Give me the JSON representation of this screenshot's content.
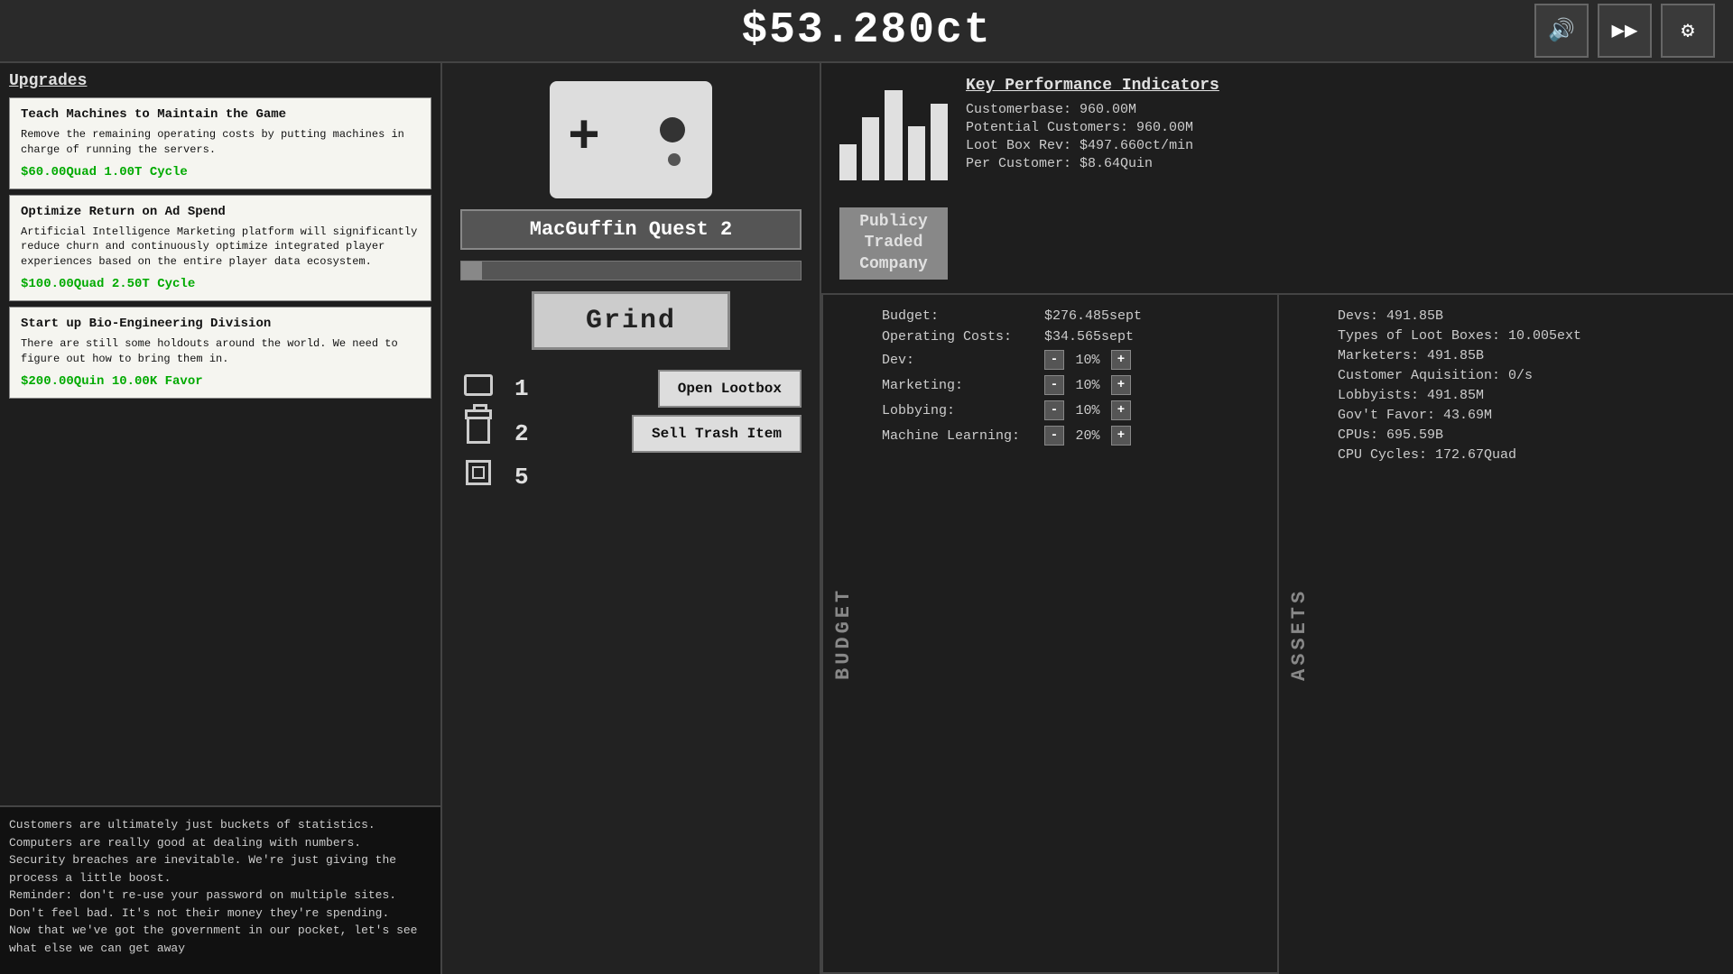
{
  "topbar": {
    "money": "$53.280ct"
  },
  "icons": {
    "sound": "🔊",
    "play": "▶",
    "settings": "⚙"
  },
  "upgrades": {
    "title": "Upgrades",
    "cards": [
      {
        "name": "Teach Machines to Maintain the Game",
        "desc": "Remove the remaining operating costs by putting machines in charge of running the servers.",
        "cost": "$60.00Quad  1.00T Cycle"
      },
      {
        "name": "Optimize Return on Ad Spend",
        "desc": "Artificial Intelligence Marketing platform will significantly reduce churn and continuously optimize integrated player experiences based on the entire player data ecosystem.",
        "cost": "$100.00Quad  2.50T Cycle"
      },
      {
        "name": "Start up Bio-Engineering Division",
        "desc": "There are still some holdouts around the world. We need to figure out how to bring them in.",
        "cost": "$200.00Quin  10.00K Favor"
      }
    ]
  },
  "log": {
    "lines": [
      "Customers are ultimately just buckets of statistics. Computers are really good at dealing with numbers.",
      "Security breaches are inevitable. We're just giving the process a little boost.",
      "Reminder: don't re-use your password on multiple sites.",
      "Don't feel bad. It's not their money they're spending.",
      "Now that we've got the government in our pocket, let's see what else we can get away"
    ]
  },
  "game": {
    "title": "MacGuffin Quest 2",
    "grind_label": "Grind",
    "progress": 6
  },
  "inventory": {
    "card_icon": "card",
    "card_count": "1",
    "trash_icon": "trash",
    "trash_count": "2",
    "cpu_icon": "cpu",
    "cpu_count": "5",
    "open_lootbox_label": "Open Lootbox",
    "sell_trash_label": "Sell Trash Item"
  },
  "kpi": {
    "title": "Key Performance Indicators",
    "company_label": "Publicy Traded\nCompany",
    "rows": [
      {
        "label": "Customerbase:",
        "value": "960.00M"
      },
      {
        "label": "Potential Customers:",
        "value": "960.00M"
      },
      {
        "label": "Loot Box Rev:",
        "value": "$497.660ct/min"
      },
      {
        "label": "Per Customer:",
        "value": "$8.64Quin"
      }
    ],
    "chart_bars": [
      40,
      70,
      100,
      60,
      85
    ]
  },
  "budget": {
    "section_label": "BUDGET",
    "rows": [
      {
        "label": "Budget:",
        "value": "$276.485sept",
        "has_controls": false
      },
      {
        "label": "Operating Costs:",
        "value": "$34.565sept",
        "has_controls": false
      },
      {
        "label": "Dev:",
        "value": "",
        "pct": "10%",
        "has_controls": true
      },
      {
        "label": "Marketing:",
        "value": "",
        "pct": "10%",
        "has_controls": true
      },
      {
        "label": "Lobbying:",
        "value": "",
        "pct": "10%",
        "has_controls": true
      },
      {
        "label": "Machine Learning:",
        "value": "",
        "pct": "20%",
        "has_controls": true
      }
    ]
  },
  "assets": {
    "section_label": "ASSETS",
    "rows": [
      {
        "label": "Devs:",
        "value": "491.85B"
      },
      {
        "label": "Types of Loot Boxes:",
        "value": "10.005ext"
      },
      {
        "label": "Marketers:",
        "value": "491.85B"
      },
      {
        "label": "Customer Aquisition:",
        "value": "0/s"
      },
      {
        "label": "Lobbyists:",
        "value": "491.85M"
      },
      {
        "label": "Gov't Favor:",
        "value": "43.69M"
      },
      {
        "label": "CPUs:",
        "value": "695.59B"
      },
      {
        "label": "CPU Cycles:",
        "value": "172.67Quad"
      }
    ]
  }
}
